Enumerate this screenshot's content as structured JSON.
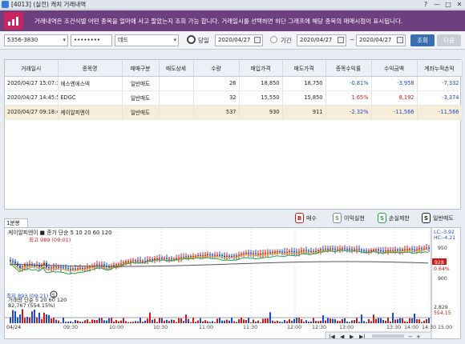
{
  "window": {
    "title": "[4013] (실전) 캐치 거래내역",
    "buttons": [
      "?",
      "—",
      "□",
      "✕"
    ]
  },
  "banner": {
    "message": "거래내역은 조건식별 어떤 종목을 얼마에 사고 팔았는지 조회 가능 합니다. 거래일시를 선택하면 하단 그래프에 해당 종목의 매매시점이 표시됩니다."
  },
  "search": {
    "account": "5356-3830",
    "password": "••••••••",
    "condition": "데드",
    "today_label": "당일",
    "today_date": "2020/04/27",
    "period_label": "기간",
    "start_date": "2020/04/27",
    "range_sep": "~",
    "end_date": "2020/04/27",
    "search_btn": "조회",
    "next_btn": "다음"
  },
  "table": {
    "headers": [
      "거래일시",
      "종목명",
      "매매구분",
      "매도상세",
      "수량",
      "매입가격",
      "매도가격",
      "종목수익률",
      "수익금액",
      "계좌누적손익"
    ],
    "rows": [
      {
        "time": "2020/04/27 15:07:31",
        "name": "에스엔에스텍",
        "type": "일반매도",
        "detail": "",
        "qty": "26",
        "buy": "18,850",
        "sell": "18,750",
        "rate": "-0.81%",
        "amount": "-3,958",
        "cum": "-7,332"
      },
      {
        "time": "2020/04/27 14:45:52",
        "name": "EDGC",
        "type": "일반매도",
        "detail": "",
        "qty": "32",
        "buy": "15,550",
        "sell": "15,850",
        "rate": "1.65%",
        "amount": "8,192",
        "cum": "-3,374"
      },
      {
        "time": "2020/04/27 09:18:48",
        "name": "케이알피엔이",
        "type": "일반매도",
        "detail": "",
        "qty": "537",
        "buy": "930",
        "sell": "911",
        "rate": "-2.32%",
        "amount": "-11,566",
        "cum": "-11,566"
      }
    ]
  },
  "chart_tab": "1분봉",
  "legend": [
    {
      "mark": "B",
      "label": "매수",
      "color": "#d01818"
    },
    {
      "mark": "S",
      "label": "이익실현",
      "color": "#888888"
    },
    {
      "mark": "S",
      "label": "손실제한",
      "color": "#2aa04a"
    },
    {
      "mark": "S",
      "label": "일반매도",
      "color": "#222222"
    }
  ],
  "chart": {
    "price_header": "케이알피엔이 ■ 종가 단순 5 10 20 60 120",
    "high_label": "최고 989 (09:01)",
    "low_label": "최저 893 (09:21)",
    "right_top1": "LC:-3.92",
    "right_top2": "HC:-4.21",
    "right_950": "950",
    "right_price_tag": "928",
    "right_pct": "0.64%",
    "right_900": "900",
    "vol_header": "거래량 단순 5 20 60 120",
    "vol_val": "82,767 (554.15%)",
    "vol_right1": "2,829",
    "vol_right2": "554.15",
    "x_labels": [
      "04/24",
      "09:30",
      "10:00",
      "10:30",
      "11:00",
      "11:30",
      "12:00",
      "12:30",
      "13:00",
      "13:30",
      "14:00",
      "14:30",
      "15:00",
      "15:30"
    ]
  },
  "colors": {
    "banner_bg": "#6d3f7e",
    "accent": "#3c6fb0",
    "up": "#d01818",
    "down": "#1d48c7"
  }
}
